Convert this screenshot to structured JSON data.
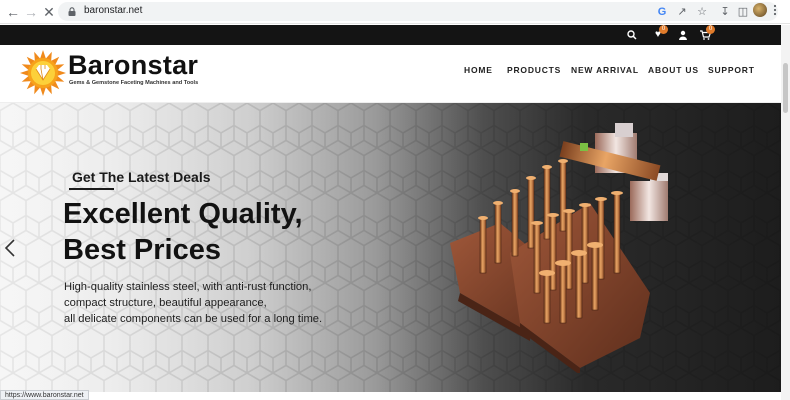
{
  "browser": {
    "url": "baronstar.net",
    "status_url": "https://www.baronstar.net"
  },
  "topbar": {
    "wishlist_count": "0",
    "cart_count": "0"
  },
  "brand": {
    "name": "Baronstar",
    "tagline": "Gems & Gemstone Faceting Machines and Tools"
  },
  "nav": {
    "items": [
      "HOME",
      "PRODUCTS",
      "NEW ARRIVAL",
      "ABOUT US",
      "SUPPORT"
    ]
  },
  "hero": {
    "eyebrow": "Get The Latest Deals",
    "headline_line1": "Excellent Quality,",
    "headline_line2": "Best Prices",
    "body_line1": "High-quality stainless steel, with anti-rust function,",
    "body_line2": "compact structure, beautiful appearance,",
    "body_line3": "all delicate components can be used for a long time."
  },
  "colors": {
    "accent": "#e07b2b",
    "topbar": "#141414"
  }
}
